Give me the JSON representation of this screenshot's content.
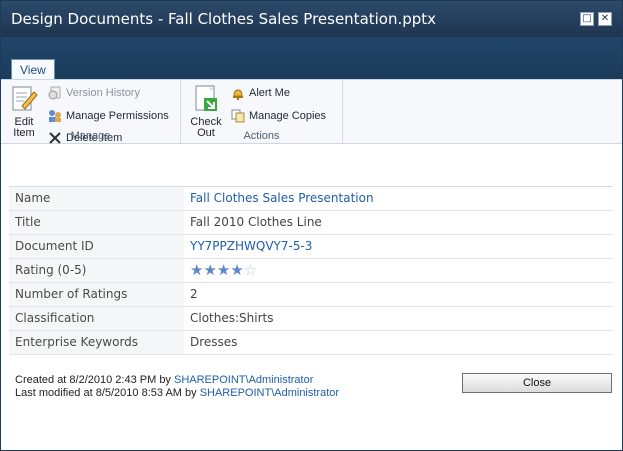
{
  "window": {
    "title": "Design Documents - Fall Clothes Sales Presentation.pptx",
    "buttons": [
      "minimize",
      "close"
    ]
  },
  "ribbon": {
    "tab_view": "View",
    "manage": {
      "label": "Manage",
      "edit_item": "Edit Item",
      "version_history": "Version History",
      "manage_permissions": "Manage Permissions",
      "delete_item": "Delete Item"
    },
    "actions": {
      "label": "Actions",
      "check_out": "Check Out",
      "alert_me": "Alert Me",
      "manage_copies": "Manage Copies"
    }
  },
  "properties": [
    {
      "label": "Name",
      "value": "Fall Clothes Sales Presentation",
      "link": true
    },
    {
      "label": "Title",
      "value": "Fall 2010 Clothes Line",
      "link": false
    },
    {
      "label": "Document ID",
      "value": "YY7PPZHWQVY7-5-3",
      "link": true
    },
    {
      "label": "Rating (0-5)",
      "value": "",
      "rating": 4,
      "max": 5
    },
    {
      "label": "Number of Ratings",
      "value": "2",
      "link": false
    },
    {
      "label": "Classification",
      "value": "Clothes:Shirts",
      "link": false
    },
    {
      "label": "Enterprise Keywords",
      "value": "Dresses",
      "link": false
    }
  ],
  "footer": {
    "created_prefix": "Created at 8/2/2010 2:43 PM by ",
    "created_by": "SHAREPOINT\\Administrator",
    "modified_prefix": "Last modified at 8/5/2010 8:53 AM by ",
    "modified_by": "SHAREPOINT\\Administrator",
    "close_label": "Close"
  },
  "colors": {
    "titlebar": "#1f3550",
    "link": "#1f5ea8",
    "star_on": "#5e86c8",
    "star_off": "#c7cdd4"
  }
}
